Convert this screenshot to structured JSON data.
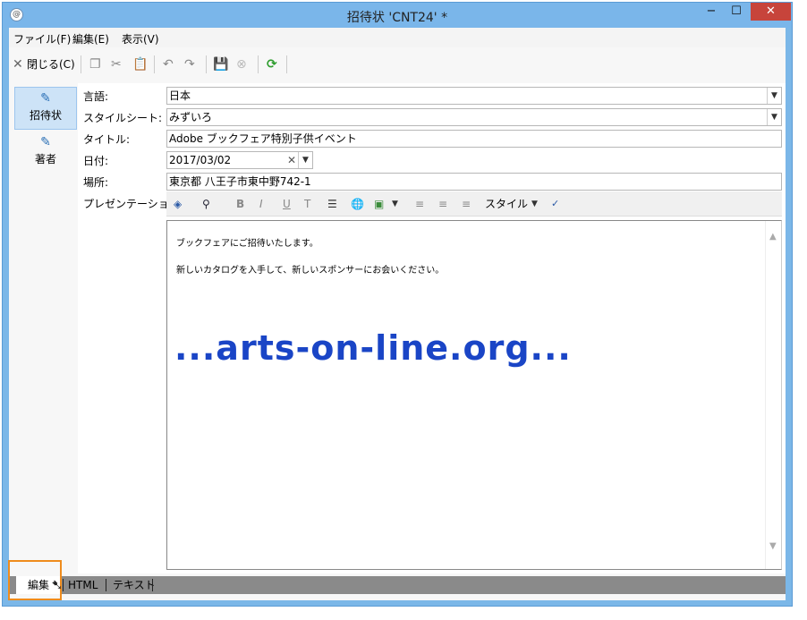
{
  "window": {
    "title": "招待状 'CNT24' *",
    "min_label": "−",
    "max_label": "☐",
    "close_label": "✕"
  },
  "menu": {
    "file": "ファイル(F)",
    "edit": "編集(E)",
    "view": "表示(V)"
  },
  "toolbar": {
    "close_label": "閉じる(C)"
  },
  "nav": {
    "items": [
      {
        "label": "招待状"
      },
      {
        "label": "著者"
      }
    ]
  },
  "form": {
    "language_label": "言語:",
    "language_value": "日本",
    "stylesheet_label": "スタイルシート:",
    "stylesheet_value": "みずいろ",
    "title_label": "タイトル:",
    "title_value": "Adobe ブックフェア特別子供イベント",
    "date_label": "日付:",
    "date_value": "2017/03/02",
    "place_label": "場所:",
    "place_value": "東京都 八王子市東中野742-1",
    "presentation_label": "プレゼンテーション:"
  },
  "editor": {
    "style_label": "スタイル",
    "line1": "ブックフェアにご招待いたします。",
    "line2": "新しいカタログを入手して、新しいスポンサーにお会いください。",
    "watermark": "...arts-on-line.org..."
  },
  "tabs": {
    "edit": "編集",
    "html": "HTML",
    "text": "テキスト"
  },
  "colors": {
    "accent": "#7ab6ea",
    "watermark": "#1a45c6",
    "highlight": "#ef8c1d"
  }
}
